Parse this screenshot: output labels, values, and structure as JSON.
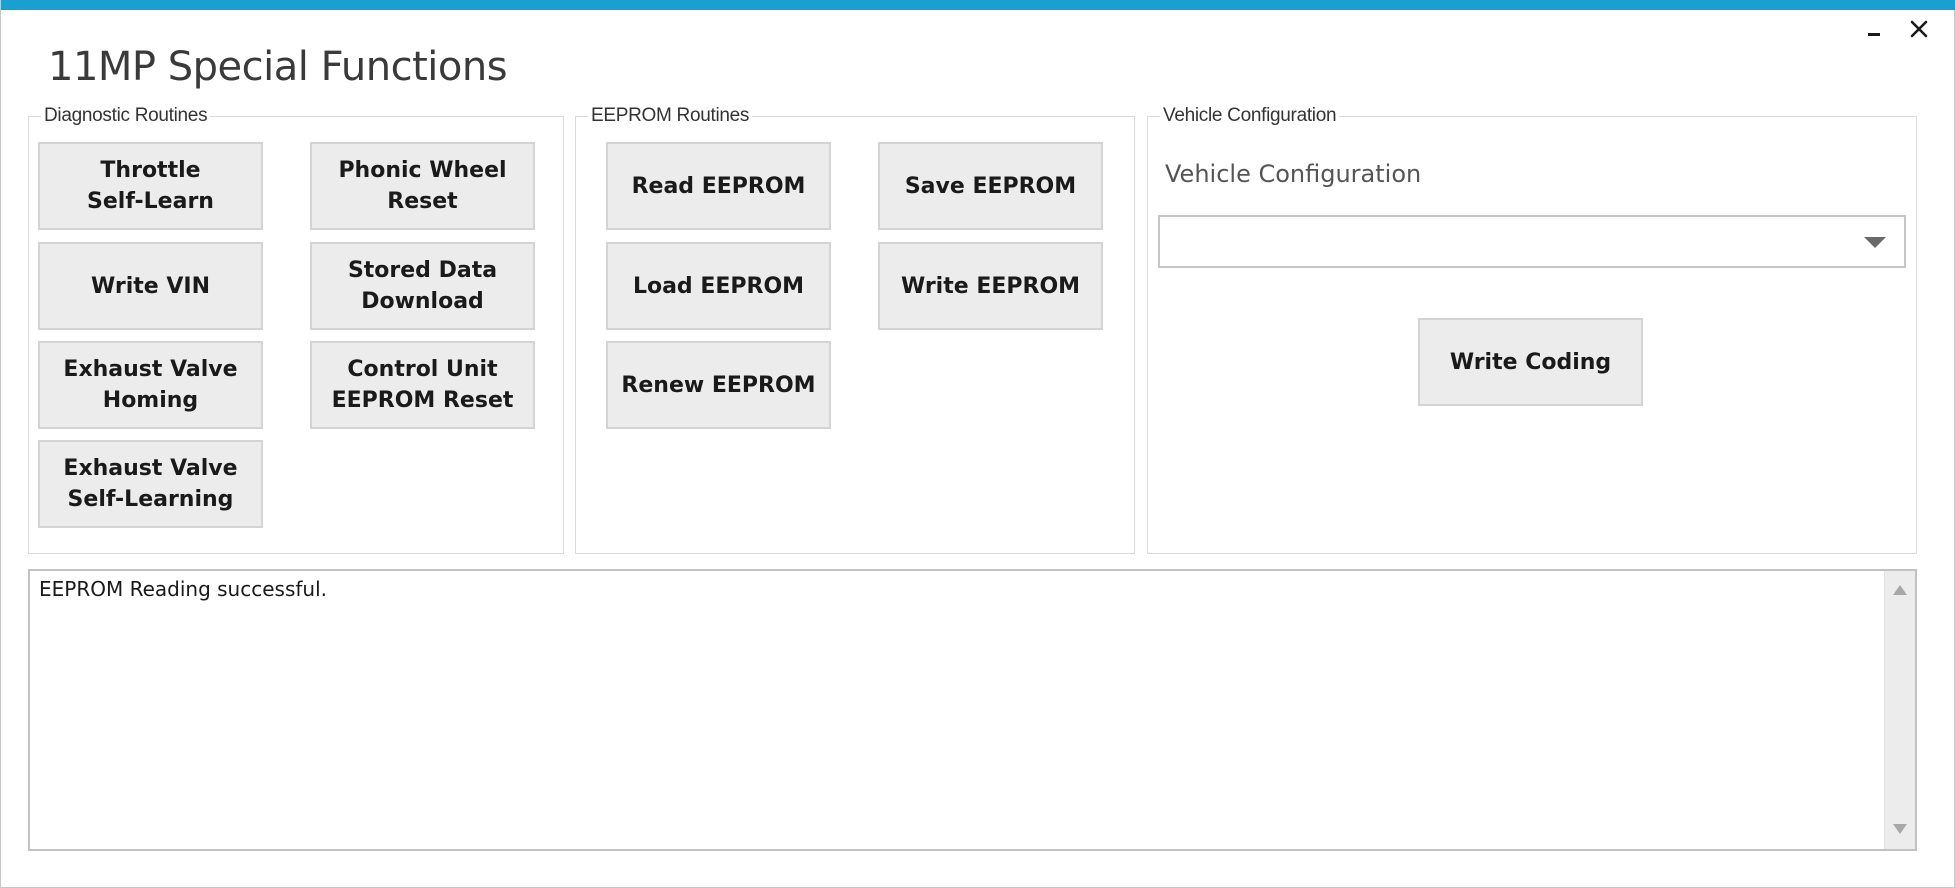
{
  "window": {
    "title": "11MP Special Functions",
    "accent_color": "#1aa0d0",
    "minimize_icon": "minimize-icon",
    "close_icon": "close-icon"
  },
  "diagnostic": {
    "legend": "Diagnostic Routines",
    "buttons": [
      "Throttle\nSelf-Learn",
      "Phonic Wheel\nReset",
      "Write VIN",
      "Stored Data\nDownload",
      "Exhaust Valve\nHoming",
      "Control Unit\nEEPROM Reset",
      "Exhaust Valve\nSelf-Learning"
    ]
  },
  "eeprom": {
    "legend": "EEPROM Routines",
    "buttons": [
      "Read EEPROM",
      "Save EEPROM",
      "Load EEPROM",
      "Write EEPROM",
      "Renew EEPROM"
    ]
  },
  "vehicle": {
    "legend": "Vehicle Configuration",
    "label": "Vehicle Configuration",
    "select_value": "",
    "select_arrow_icon": "chevron-down-icon",
    "write_coding": "Write Coding"
  },
  "log": {
    "text": "EEPROM Reading successful."
  }
}
